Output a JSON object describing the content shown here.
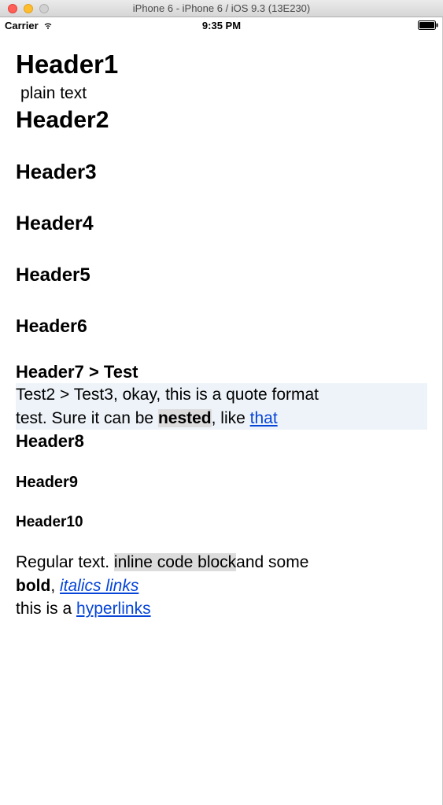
{
  "window": {
    "title": "iPhone 6 - iPhone 6 / iOS 9.3 (13E230)"
  },
  "status_bar": {
    "carrier": "Carrier",
    "time": "9:35 PM"
  },
  "content": {
    "h1": "Header1",
    "plain": "plain text",
    "h2": "Header2",
    "h3": "Header3",
    "h4": "Header4",
    "h5": "Header5",
    "h6": "Header6",
    "h7": "Header7 > Test",
    "quote": {
      "line1_prefix": "Test2  > Test3, okay, this is a quote format ",
      "line2_prefix": "test. Sure it can be ",
      "nested": "nested",
      "line2_mid": ", like ",
      "that_link": "that"
    },
    "h8": "Header8",
    "h9": "Header9",
    "h10": "Header10",
    "paragraph": {
      "p1": "Regular text. ",
      "code": "inline code block",
      "p2": "and some ",
      "bold": "bold",
      "p3": ", ",
      "italics_link": "italics links",
      "p4": "this is a ",
      "hyperlink": "hyperlinks"
    }
  }
}
